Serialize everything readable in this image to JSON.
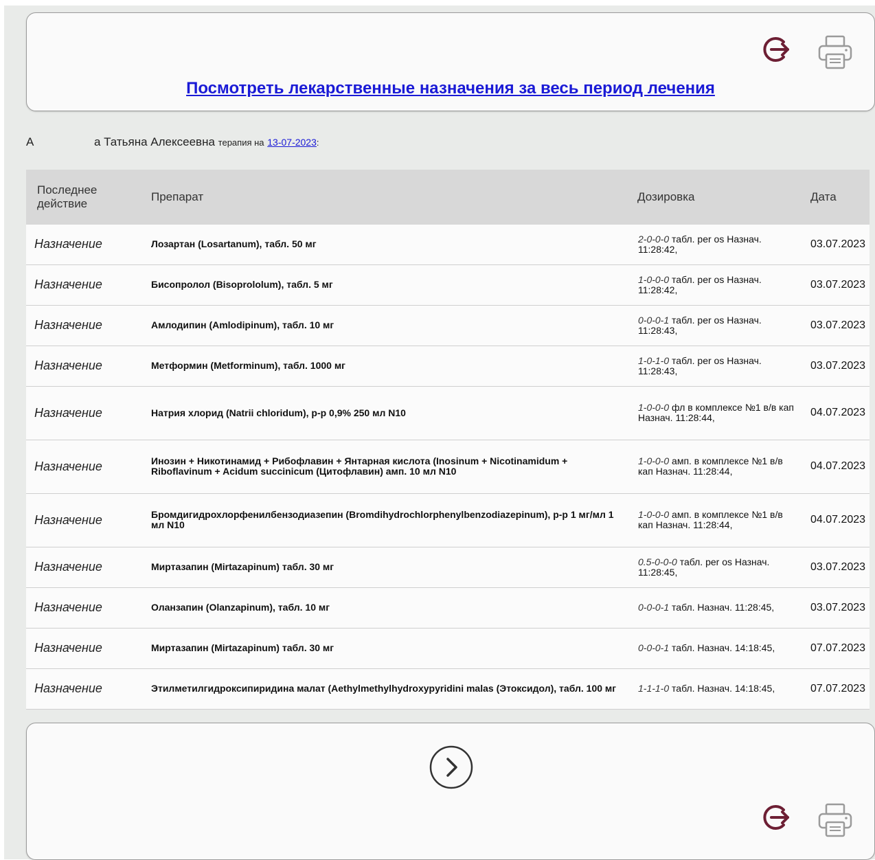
{
  "colors": {
    "accent": "#6d1f34",
    "link": "#1a1ad6",
    "header_bg": "#d8d8d8"
  },
  "top_panel": {
    "link_text": "Посмотреть лекарственные назначения за весь период лечения",
    "icons": [
      "logout-icon",
      "printer-icon"
    ]
  },
  "patient": {
    "name_part1": "А",
    "name_part2": "а Татьяна Алексеевна",
    "therapy_label": "терапия на",
    "date_link": "13-07-2023",
    "suffix": ":"
  },
  "table": {
    "headers": [
      "Последнее действие",
      "Препарат",
      "Дозировка",
      "Дата"
    ],
    "rows": [
      {
        "action": "Назначение",
        "drug": "Лозартан (Losartanum), табл. 50 мг",
        "dose_code": "2-0-0-0",
        "dose_text": " табл. per os Назнач. 11:28:42,",
        "date": "03.07.2023",
        "height": 58
      },
      {
        "action": "Назначение",
        "drug": "Бисопролол (Bisoprololum), табл. 5 мг",
        "dose_code": "1-0-0-0",
        "dose_text": " табл. per os Назнач. 11:28:42,",
        "date": "03.07.2023",
        "height": 59
      },
      {
        "action": "Назначение",
        "drug": "Амлодипин (Amlodipinum), табл. 10 мг",
        "dose_code": "0-0-0-1",
        "dose_text": " табл. per os Назнач. 11:28:43,",
        "date": "03.07.2023",
        "height": 59
      },
      {
        "action": "Назначение",
        "drug": "Метформин (Metforminum), табл. 1000 мг",
        "dose_code": "1-0-1-0",
        "dose_text": " табл. per os Назнач. 11:28:43,",
        "date": "03.07.2023",
        "height": 59
      },
      {
        "action": "Назначение",
        "drug": "Натрия хлорид (Natrii chloridum), р-р 0,9% 250 мл N10",
        "dose_code": "1-0-0-0",
        "dose_text": " фл в комплексе №1 в/в кап Назнач. 11:28:44,",
        "date": "04.07.2023",
        "height": 78
      },
      {
        "action": "Назначение",
        "drug": "Инозин + Никотинамид + Рибофлавин + Янтарная кислота (Inosinum + Nicotinamidum + Riboflavinum + Acidum succinicum (Цитофлавин) амп. 10 мл N10",
        "dose_code": "1-0-0-0",
        "dose_text": " амп. в комплексе №1 в/в кап Назнач. 11:28:44,",
        "date": "04.07.2023",
        "height": 78
      },
      {
        "action": "Назначение",
        "drug": "Бромдигидрохлорфенилбензодиазепин (Bromdihydrochlorphenylbenzodiazepinum), р-р 1 мг/мл 1 мл N10",
        "dose_code": "1-0-0-0",
        "dose_text": " амп. в комплексе №1 в/в кап Назнач. 11:28:44,",
        "date": "04.07.2023",
        "height": 78
      },
      {
        "action": "Назначение",
        "drug": "Миртазапин (Mirtazapinum) табл. 30 мг",
        "dose_code": "0.5-0-0-0",
        "dose_text": " табл. per os Назнач. 11:28:45,",
        "date": "03.07.2023",
        "height": 59
      },
      {
        "action": "Назначение",
        "drug": "Оланзапин (Olanzapinum), табл. 10 мг",
        "dose_code": "0-0-0-1",
        "dose_text": " табл. Назнач. 11:28:45,",
        "date": "03.07.2023",
        "height": 59
      },
      {
        "action": "Назначение",
        "drug": "Миртазапин (Mirtazapinum) табл. 30 мг",
        "dose_code": "0-0-0-1",
        "dose_text": " табл. Назнач. 14:18:45,",
        "date": "07.07.2023",
        "height": 59
      },
      {
        "action": "Назначение",
        "drug": "Этилметилгидроксипиридина малат (Aethylmethylhydroxypyridini malas (Этоксидол), табл. 100 мг",
        "dose_code": "1-1-1-0",
        "dose_text": " табл. Назнач. 14:18:45,",
        "date": "07.07.2023",
        "height": 59
      }
    ]
  },
  "bottom_panel": {
    "icons": [
      "next-circle-icon",
      "logout-icon",
      "printer-icon"
    ]
  }
}
